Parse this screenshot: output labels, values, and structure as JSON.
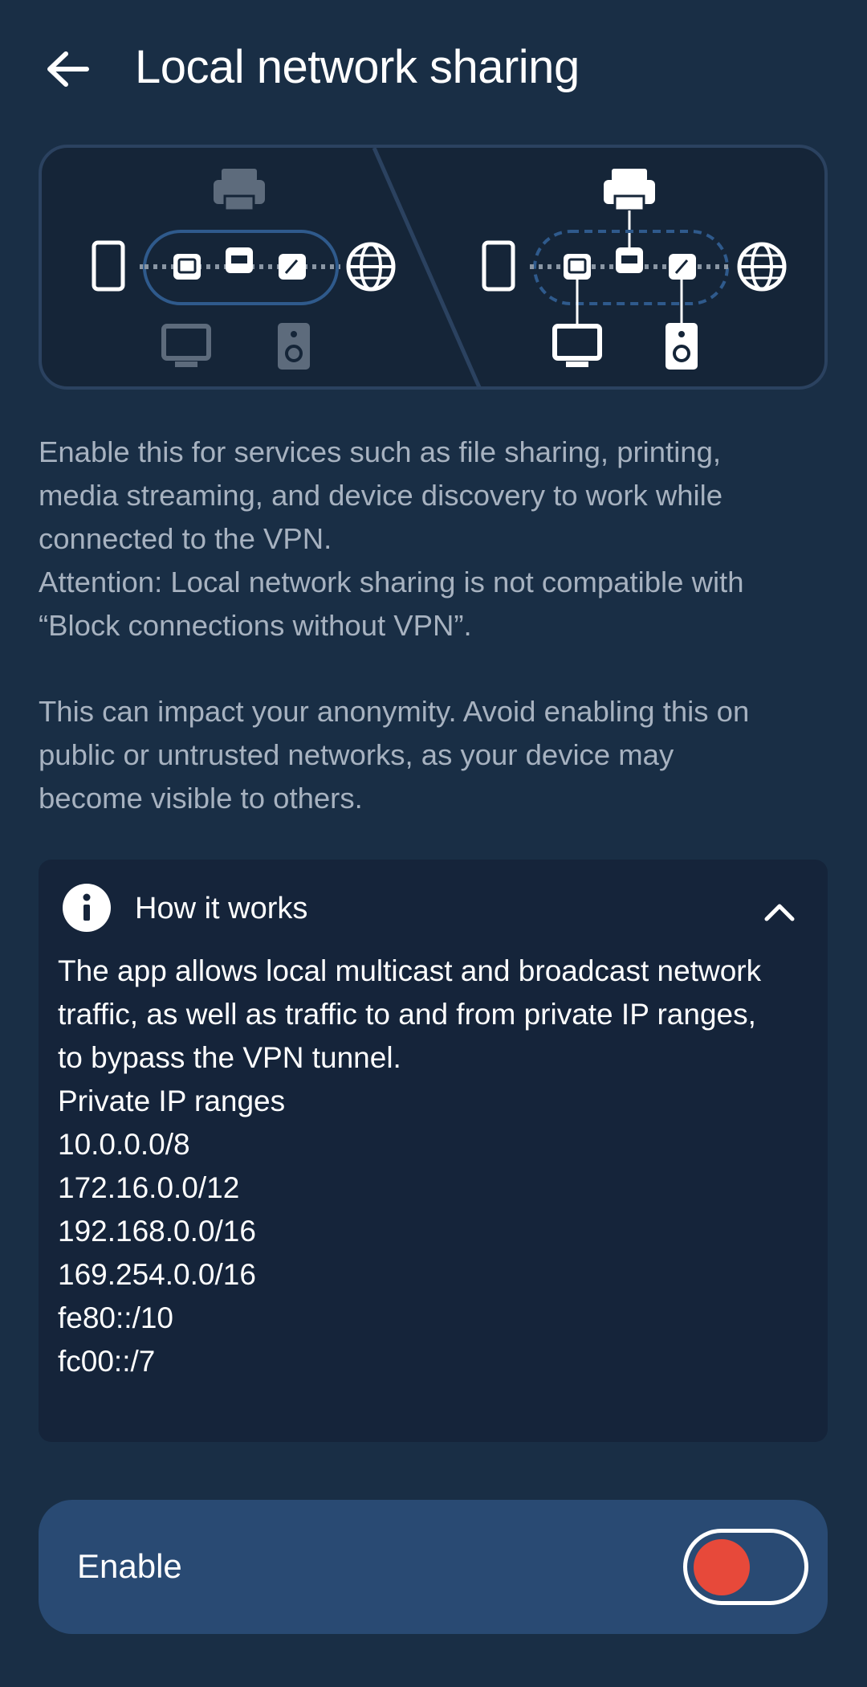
{
  "header": {
    "title": "Local network sharing",
    "back_icon": "arrow-left-icon"
  },
  "description": {
    "paragraph1_line1": "Enable this for services such as file sharing, printing,",
    "paragraph1_line2": "media streaming, and device discovery to work while",
    "paragraph1_line3": "connected to the VPN.",
    "paragraph1_line4": "Attention: Local network sharing is not compatible with",
    "paragraph1_line5": "“Block connections without VPN”.",
    "paragraph2_line1": "This can impact your anonymity. Avoid enabling this on",
    "paragraph2_line2": "public or untrusted networks, as your device may",
    "paragraph2_line3": "become visible to others."
  },
  "how_it_works": {
    "title": "How it works",
    "expanded": true,
    "body_line1": "The app allows local multicast and broadcast network",
    "body_line2": "traffic, as well as traffic to and from private IP ranges,",
    "body_line3": "to bypass the VPN tunnel.",
    "ranges_title": "Private IP ranges",
    "ranges": [
      "10.0.0.0/8",
      "172.16.0.0/12",
      "192.168.0.0/16",
      "169.254.0.0/16",
      "fe80::/10",
      "fc00::/7"
    ]
  },
  "enable": {
    "label": "Enable",
    "toggle_on": false
  },
  "colors": {
    "background": "#192e45",
    "card": "#15243a",
    "enable_row": "#294a73",
    "toggle_knob": "#e7493a",
    "muted_text": "#a7b2c0"
  }
}
